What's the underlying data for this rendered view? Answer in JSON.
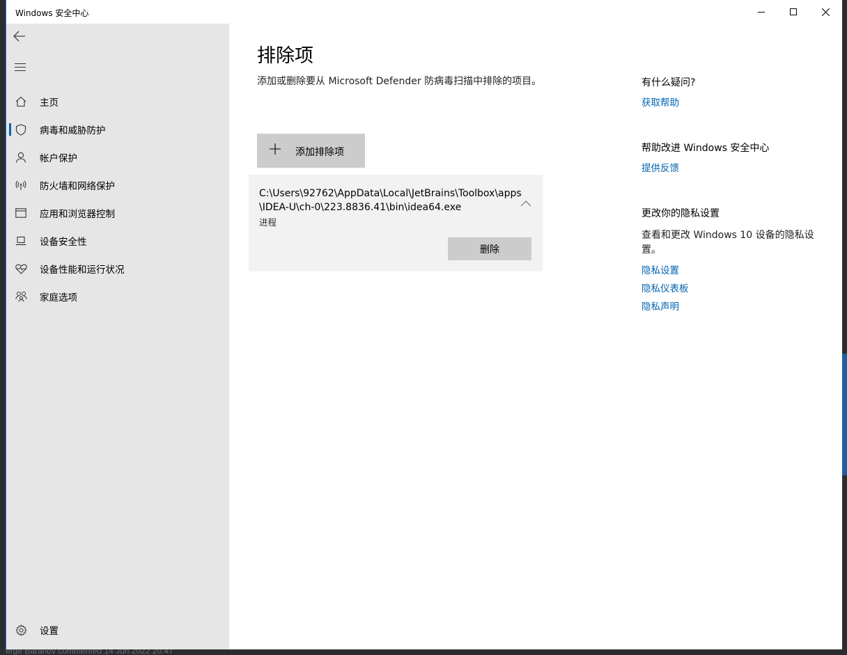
{
  "window": {
    "title": "Windows 安全中心"
  },
  "sidebar": {
    "items": [
      {
        "label": "主页",
        "icon": "home-icon"
      },
      {
        "label": "病毒和威胁防护",
        "icon": "shield-icon",
        "active": true
      },
      {
        "label": "帐户保护",
        "icon": "person-icon"
      },
      {
        "label": "防火墙和网络保护",
        "icon": "wifi-antenna-icon"
      },
      {
        "label": "应用和浏览器控制",
        "icon": "browser-window-icon"
      },
      {
        "label": "设备安全性",
        "icon": "laptop-icon"
      },
      {
        "label": "设备性能和运行状况",
        "icon": "heart-pulse-icon"
      },
      {
        "label": "家庭选项",
        "icon": "family-icon"
      }
    ],
    "settings_label": "设置"
  },
  "main": {
    "title": "排除项",
    "description": "添加或删除要从 Microsoft Defender 防病毒扫描中排除的项目。",
    "add_button_label": "添加排除项",
    "exclusion": {
      "path": "C:\\Users\\92762\\AppData\\Local\\JetBrains\\Toolbox\\apps\\IDEA-U\\ch-0\\223.8836.41\\bin\\idea64.exe",
      "type": "进程",
      "delete_label": "删除"
    }
  },
  "aside": {
    "help_heading": "有什么疑问?",
    "help_link": "获取帮助",
    "improve_heading": "帮助改进 Windows 安全中心",
    "feedback_link": "提供反馈",
    "privacy_heading": "更改你的隐私设置",
    "privacy_text": "查看和更改 Windows 10 设备的隐私设置。",
    "privacy_links": [
      "隐私设置",
      "隐私仪表板",
      "隐私声明"
    ]
  },
  "background": {
    "bottom_text": "erge Baranov commented 14 Jun 2022 20:47"
  },
  "colors": {
    "accent": "#0063b1",
    "sidebar_bg": "#e6e6e6",
    "button_bg": "#cccccc",
    "card_bg": "#f2f2f2"
  }
}
